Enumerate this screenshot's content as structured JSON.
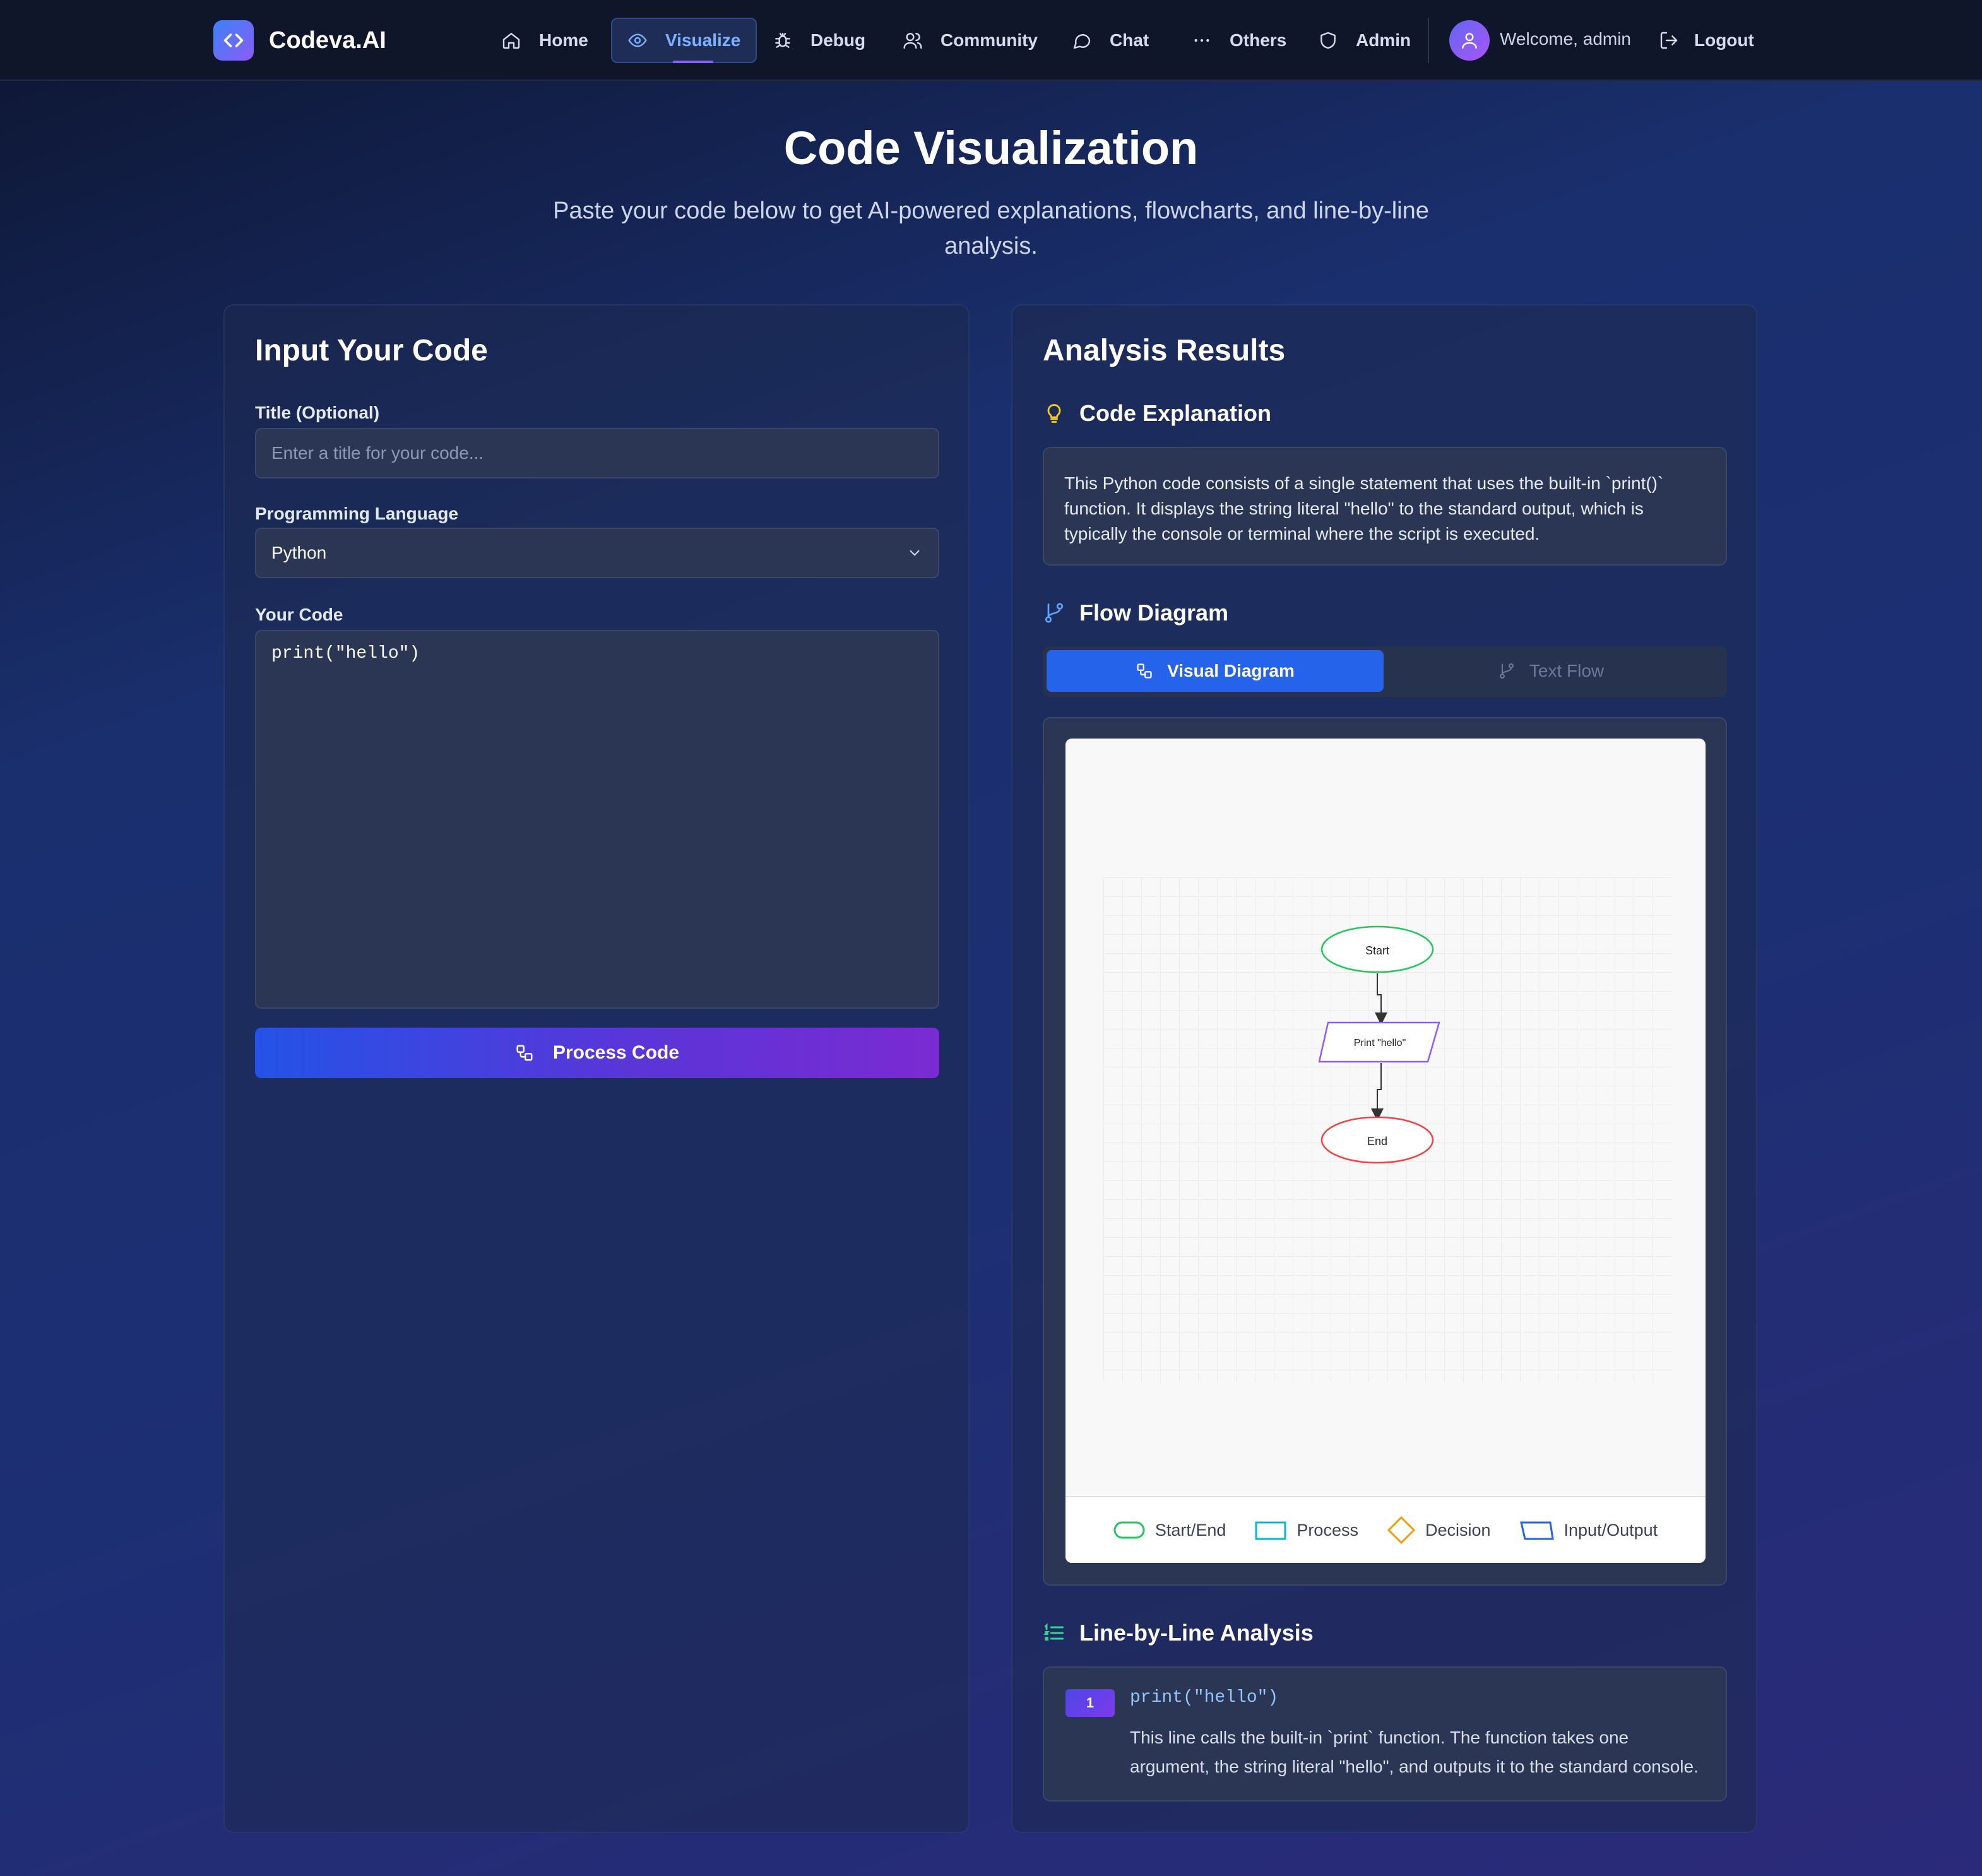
{
  "brand": {
    "name": "Codeva.AI"
  },
  "nav": {
    "items": [
      {
        "label": "Home",
        "icon": "home-icon"
      },
      {
        "label": "Visualize",
        "icon": "eye-icon",
        "active": true
      },
      {
        "label": "Debug",
        "icon": "bug-icon"
      },
      {
        "label": "Community",
        "icon": "users-icon"
      },
      {
        "label": "Chat",
        "icon": "chat-icon"
      },
      {
        "label": "Others",
        "icon": "dots-icon"
      },
      {
        "label": "Admin",
        "icon": "shield-icon"
      }
    ],
    "welcome": "Welcome, admin",
    "logout": "Logout"
  },
  "hero": {
    "title": "Code Visualization",
    "subtitle": "Paste your code below to get AI-powered explanations, flowcharts, and line-by-line analysis."
  },
  "input_panel": {
    "title": "Input Your Code",
    "title_label": "Title (Optional)",
    "title_placeholder": "Enter a title for your code...",
    "language_label": "Programming Language",
    "language_value": "Python",
    "code_label": "Your Code",
    "code_value": "print(\"hello\")",
    "process_button": "Process Code"
  },
  "results_panel": {
    "title": "Analysis Results",
    "explanation_heading": "Code Explanation",
    "explanation_text": "This Python code consists of a single statement that uses the built-in `print()` function. It displays the string literal \"hello\" to the standard output, which is typically the console or terminal where the script is executed.",
    "flow_heading": "Flow Diagram",
    "tab_visual": "Visual Diagram",
    "tab_text": "Text Flow",
    "diagram": {
      "start": "Start",
      "process": "Print \"hello\"",
      "end": "End"
    },
    "legend": [
      "Start/End",
      "Process",
      "Decision",
      "Input/Output"
    ],
    "line_heading": "Line-by-Line Analysis",
    "lines": [
      {
        "number": "1",
        "code": "print(\"hello\")",
        "description": "This line calls the built-in `print` function. The function takes one argument, the string literal \"hello\", and outputs it to the standard console."
      }
    ]
  },
  "colors": {
    "accent": "#2563eb",
    "start_end": "#22c55e",
    "end_node": "#ef4444",
    "io_node": "#8b5cf6",
    "process": "#06b6d4",
    "decision": "#f59e0b"
  }
}
